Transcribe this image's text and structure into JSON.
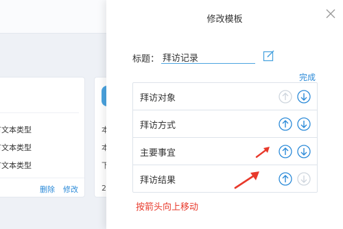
{
  "background": {
    "card1_rows": [
      "有文本类型",
      "有文本类型",
      "有文本类型"
    ],
    "card1_actions": {
      "delete": "删除",
      "edit": "修改"
    },
    "card2_rows": [
      "本",
      "本",
      "下",
      "2"
    ]
  },
  "panel": {
    "title": "修改模板",
    "title_field": {
      "label": "标题：",
      "value": "拜访记录"
    },
    "done_label": "完成",
    "items": [
      {
        "label": "拜访对象",
        "up_enabled": false,
        "down_enabled": true
      },
      {
        "label": "拜访方式",
        "up_enabled": true,
        "down_enabled": true
      },
      {
        "label": "主要事宜",
        "up_enabled": true,
        "down_enabled": true
      },
      {
        "label": "拜访结果",
        "up_enabled": true,
        "down_enabled": false
      }
    ],
    "annotation": "按箭头向上移动"
  },
  "colors": {
    "accent": "#2b8ad8",
    "disabled": "#cfd6de",
    "annotation": "#e8392b"
  }
}
